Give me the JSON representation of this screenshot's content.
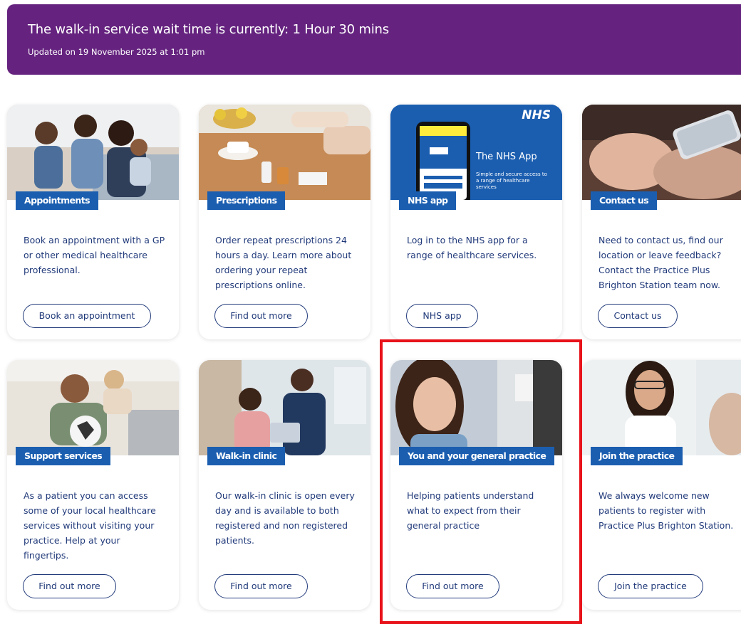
{
  "banner": {
    "title": "The walk-in service wait time is currently: 1 Hour 30 mins",
    "updated": "Updated on 19 November 2025 at 1:01 pm"
  },
  "nhs_app_image": {
    "logo": "NHS",
    "title": "The NHS App",
    "subtitle": "Simple and secure access to a range of healthcare services"
  },
  "cards": [
    {
      "tag": "Appointments",
      "description": "Book an appointment with a GP or other medical healthcare professional.",
      "button": "Book an appointment"
    },
    {
      "tag": "Prescriptions",
      "description": "Order repeat prescriptions 24 hours a day. Learn more about ordering your repeat prescriptions online.",
      "button": "Find out more"
    },
    {
      "tag": "NHS app",
      "description": "Log in to the NHS app for a range of healthcare services.",
      "button": "NHS app"
    },
    {
      "tag": "Contact us",
      "description": "Need to contact us, find our location or leave feedback? Contact the Practice Plus Brighton Station team now.",
      "button": "Contact us"
    },
    {
      "tag": "Support services",
      "description": "As a patient you can access some of your local healthcare services without visiting your practice. Help at your fingertips.",
      "button": "Find out more"
    },
    {
      "tag": "Walk-in clinic",
      "description": "Our walk-in clinic is open every day and is available to both registered and non registered patients.",
      "button": "Find out more"
    },
    {
      "tag": "You and your general practice",
      "description": "Helping patients understand what to expect from their general practice",
      "button": "Find out more"
    },
    {
      "tag": "Join the practice",
      "description": "We always welcome new patients to register with Practice Plus Brighton Station.",
      "button": "Join the practice"
    }
  ],
  "colors": {
    "banner_bg": "#65237f",
    "tag_bg": "#1b5eb0",
    "text": "#213a7a",
    "highlight": "#e8121a"
  }
}
